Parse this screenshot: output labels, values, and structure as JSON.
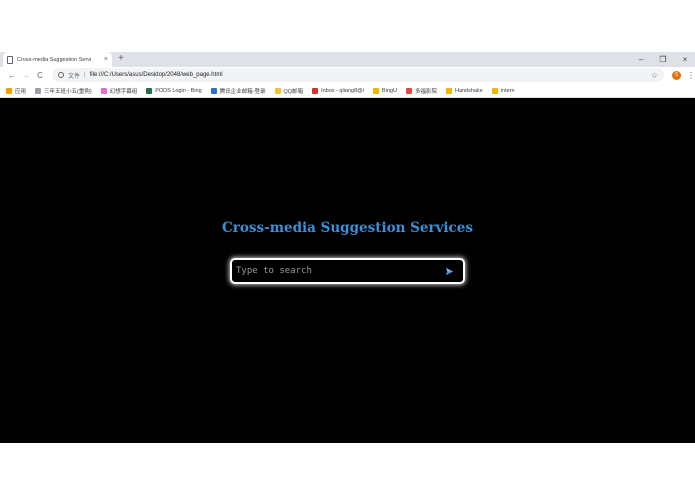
{
  "browser": {
    "tab": {
      "title": "Cross-media Suggestion Servi",
      "close": "×"
    },
    "new_tab": "+",
    "window_controls": {
      "minimize": "–",
      "restore": "❐",
      "close": "×"
    },
    "nav": {
      "back": "←",
      "forward": "→",
      "reload": "C"
    },
    "address": {
      "scheme_label": "文件",
      "separator": "|",
      "url": "file:///C:/Users/asus/Desktop/2048/web_page.html"
    },
    "bookmark_star": "☆",
    "profile_initial": "S",
    "menu": "⋮"
  },
  "bookmarks": [
    {
      "label": "应用",
      "color": "#f4a100",
      "icon": "apps-grid-icon"
    },
    {
      "label": "三年五班小五(重购)",
      "color": "#9aa0a6",
      "icon": "dash-icon"
    },
    {
      "label": "幻想字幕组",
      "color": "#e36fd4",
      "icon": "site-icon"
    },
    {
      "label": "PODS Login - Bing",
      "color": "#1f6f4a",
      "icon": "site-icon"
    },
    {
      "label": "腾讯企业邮箱-登录",
      "color": "#2a73c5",
      "icon": "mail-icon"
    },
    {
      "label": "QQ邮箱",
      "color": "#f2c230",
      "icon": "qq-icon"
    },
    {
      "label": "Inbox - qliang8@i",
      "color": "#d93025",
      "icon": "gmail-icon"
    },
    {
      "label": "BingU",
      "color": "#f4b400",
      "icon": "folder-icon"
    },
    {
      "label": "多福影院",
      "color": "#e8453c",
      "icon": "site-icon"
    },
    {
      "label": "Handshake",
      "color": "#f4b400",
      "icon": "folder-icon"
    },
    {
      "label": "intern",
      "color": "#f4b400",
      "icon": "folder-icon"
    }
  ],
  "page": {
    "title": "Cross-media Suggestion Services",
    "search": {
      "placeholder": "Type to search",
      "value": ""
    },
    "colors": {
      "title": "#3c8fd8",
      "background": "#000000"
    }
  }
}
